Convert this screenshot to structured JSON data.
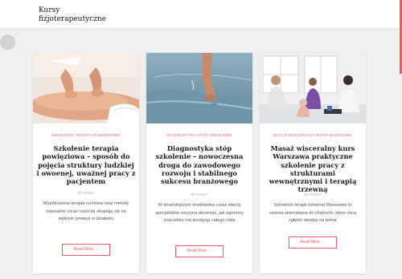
{
  "header": {
    "title_line1": "Kursy",
    "title_line2": "fizjoterapeutyczne"
  },
  "cards": [
    {
      "category": "SZKOLENIE TERAPIA POWIĘZIOWA",
      "title": "Szkolenie terapia powięziowa – sposób do pojęcia struktury ludzkiej i owoenej, uważnej pracy z pacjentem",
      "author": "BY KASIA",
      "excerpt": "Współczesna terapia ruchowa oraz metody manualne coraz częściej skupiają się na wpływie powięzi w działaniu",
      "button": "Read More →"
    },
    {
      "category": "DIAGNOSTYKA STÓP SZKOLENIE",
      "title": "Diagnostyka stóp szkolenie – nowoczesna droga do zawodowego rozwoju i stabilnego sukcesu branżowego",
      "author": "BY KASIA",
      "excerpt": "W teraźniejszym środowisku coraz więcej specjalistów zaczyna doceniać, jak ogromny znaczenie ma kondycję całego ciała",
      "button": "Read More →"
    },
    {
      "category": "MASAŻ WISCERALNY KURS WARSZAWA",
      "title": "Masaż wisceralny kurs Warszawa praktyczne szkolenie pracy z strukturami wewnętrznymi i terapią trzewną",
      "author": "BY KASIA",
      "excerpt": "Szkolenie terapii trzewnej Warszawa to szansa skierowana do chętnych, które chcą zgłębić wiedzę na temat",
      "button": "Read More →"
    }
  ],
  "colors": {
    "accent": "#e95b66",
    "background": "#efefef"
  }
}
